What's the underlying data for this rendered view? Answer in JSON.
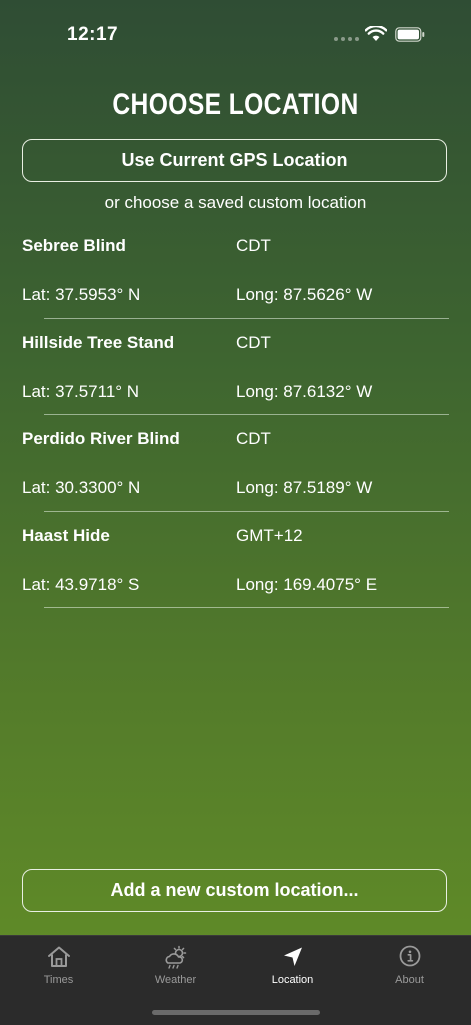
{
  "status_bar": {
    "time": "12:17"
  },
  "title": "CHOOSE LOCATION",
  "gps_button_label": "Use Current GPS Location",
  "subtitle": "or choose a saved custom location",
  "locations": [
    {
      "name": "Sebree Blind",
      "timezone": "CDT",
      "lat": "Lat: 37.5953° N",
      "long": "Long: 87.5626° W"
    },
    {
      "name": "Hillside Tree Stand",
      "timezone": "CDT",
      "lat": "Lat: 37.5711° N",
      "long": "Long: 87.6132° W"
    },
    {
      "name": "Perdido River Blind",
      "timezone": "CDT",
      "lat": "Lat: 30.3300° N",
      "long": "Long: 87.5189° W"
    },
    {
      "name": "Haast Hide",
      "timezone": "GMT+12",
      "lat": "Lat: 43.9718° S",
      "long": "Long: 169.4075° E"
    }
  ],
  "add_button_label": "Add a new custom location...",
  "tabs": [
    {
      "label": "Times",
      "icon": "house-icon",
      "active": false
    },
    {
      "label": "Weather",
      "icon": "partly-cloudy-icon",
      "active": false
    },
    {
      "label": "Location",
      "icon": "location-arrow-icon",
      "active": true
    },
    {
      "label": "About",
      "icon": "info-icon",
      "active": false
    }
  ],
  "colors": {
    "tab_active": "#ffffff",
    "tab_inactive": "#9a9a9a",
    "tabbar_bg": "#2b2b2b"
  }
}
